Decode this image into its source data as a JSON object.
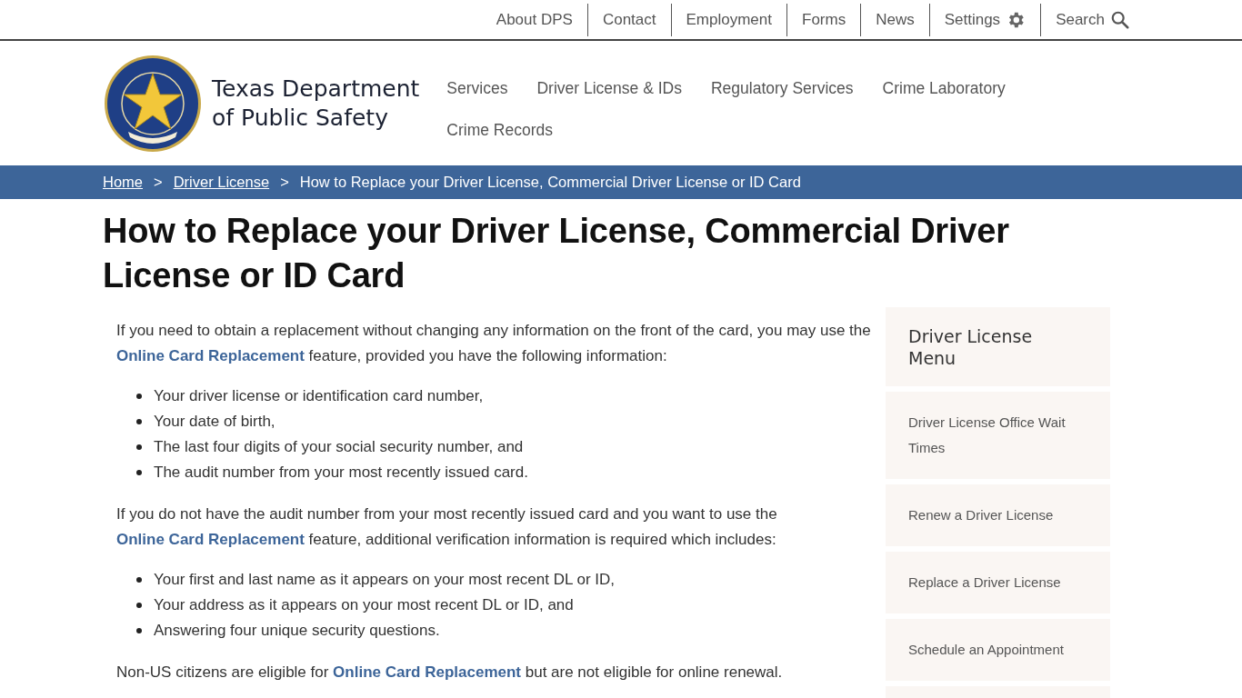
{
  "utility_nav": {
    "links": [
      "About DPS",
      "Contact",
      "Employment",
      "Forms",
      "News"
    ],
    "settings": "Settings",
    "search": "Search"
  },
  "header": {
    "title_line1": "Texas Department",
    "title_line2": "of Public Safety",
    "nav": [
      "Services",
      "Driver License & IDs",
      "Regulatory Services",
      "Crime Laboratory",
      "Crime Records"
    ]
  },
  "breadcrumb": {
    "links": [
      "Home",
      "Driver License"
    ],
    "current": "How to Replace your Driver License, Commercial Driver License or ID Card",
    "separator": ">"
  },
  "page_title": "How to Replace your Driver License, Commercial Driver License or ID Card",
  "content": [
    {
      "kind": "paragraph",
      "parts": [
        {
          "text": "If you need to obtain a replacement without changing any information on the front of the card, you may use the ",
          "link": false
        },
        {
          "text": "Online Card Replacement",
          "link": true
        },
        {
          "text": " feature, provided you have the following information:",
          "link": false
        }
      ]
    },
    {
      "kind": "list",
      "items": [
        "Your driver license or identification card number,",
        "Your date of birth,",
        "The last four digits of your social security number, and",
        "The audit number from your most recently issued card."
      ]
    },
    {
      "kind": "paragraph",
      "parts": [
        {
          "text": "If you do not have the audit number from your most recently issued card and you want to use the ",
          "link": false
        },
        {
          "text": "Online Card Replacement",
          "link": true
        },
        {
          "text": " feature, additional verification information is required which includes:",
          "link": false
        }
      ]
    },
    {
      "kind": "list",
      "items": [
        "Your first and last name as it appears on your most recent DL or ID,",
        "Your address as it appears on your most recent DL or ID, and",
        "Answering four unique security questions."
      ]
    },
    {
      "kind": "paragraph",
      "parts": [
        {
          "text": "Non-US citizens are eligible for ",
          "link": false
        },
        {
          "text": "Online Card Replacement",
          "link": true
        },
        {
          "text": " but are not eligible for online renewal.",
          "link": false
        }
      ]
    }
  ],
  "sidebar": {
    "title": "Driver License Menu",
    "items": [
      "Driver License Office Wait Times",
      "Renew a Driver License",
      "Replace a Driver License",
      "Schedule an Appointment"
    ]
  }
}
